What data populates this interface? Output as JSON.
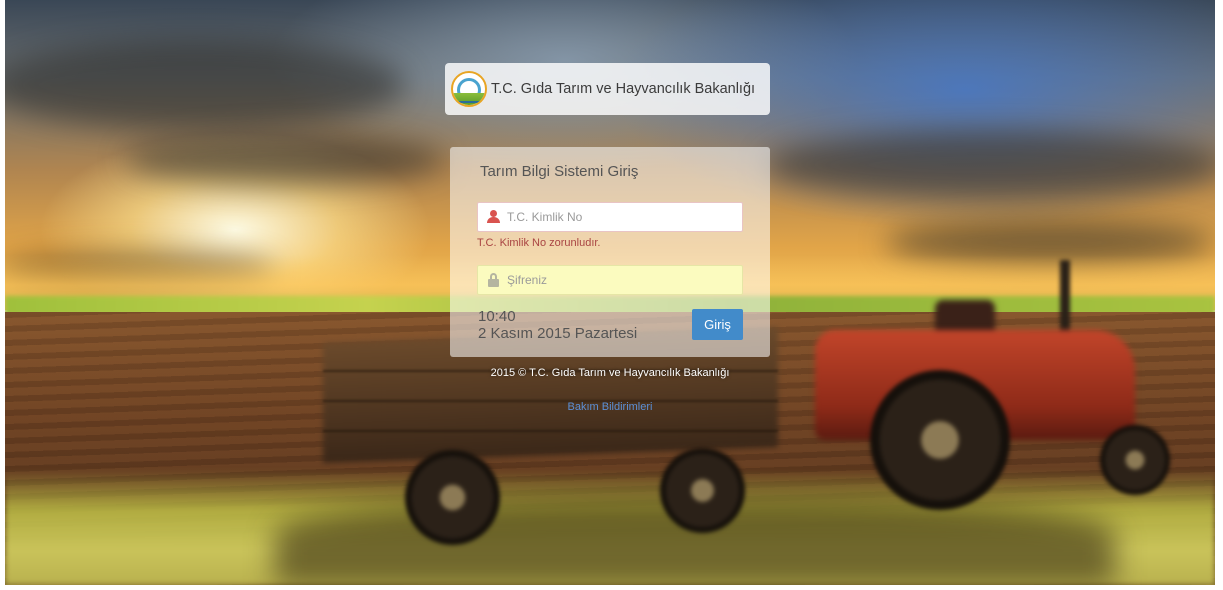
{
  "header": {
    "ministry_name": "T.C. Gıda Tarım ve Hayvancılık Bakanlığı"
  },
  "login": {
    "title": "Tarım Bilgi Sistemi Giriş",
    "tc_kimlik": {
      "placeholder": "T.C. Kimlik No",
      "value": "",
      "icon": "user-icon",
      "error": "T.C. Kimlik No zorunludır."
    },
    "password": {
      "placeholder": "Şifreniz",
      "value": "",
      "icon": "lock-icon"
    },
    "time": "10:40",
    "date": "2 Kasım 2015 Pazartesi",
    "submit_label": "Giriş"
  },
  "footer": {
    "copyright": "2015 © T.C. Gıda Tarım ve Hayvancılık Bakanlığı",
    "maintenance_link": "Bakım Bildirimleri"
  },
  "colors": {
    "primary_button": "#428bca",
    "error_text": "#a94442",
    "user_icon": "#d9534f",
    "password_field_bg": "#fbfbbf",
    "link": "#5b8fd6"
  }
}
